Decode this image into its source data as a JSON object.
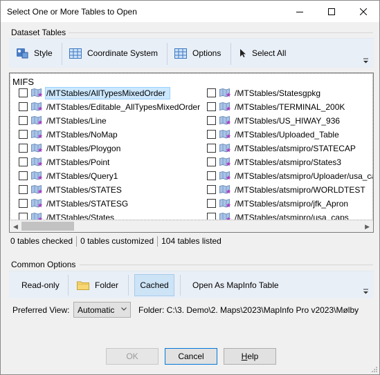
{
  "window": {
    "title": "Select One or More Tables to Open"
  },
  "dataset_group": {
    "label": "Dataset Tables",
    "toolbar": {
      "style": "Style",
      "coordinate_system": "Coordinate System",
      "options": "Options",
      "select_all": "Select All"
    }
  },
  "list": {
    "heading": "MIFS",
    "left_column": [
      "/MTStables/AllTypesMixedOrder",
      "/MTStables/Editable_AllTypesMixedOrder",
      "/MTStables/Line",
      "/MTStables/NoMap",
      "/MTStables/Ploygon",
      "/MTStables/Point",
      "/MTStables/Query1",
      "/MTStables/STATES",
      "/MTStables/STATESG",
      "/MTStables/States"
    ],
    "right_column": [
      "/MTStables/Statesgpkg",
      "/MTStables/TERMINAL_200K",
      "/MTStables/US_HIWAY_936",
      "/MTStables/Uploaded_Table",
      "/MTStables/atsmipro/STATECAP",
      "/MTStables/atsmipro/States3",
      "/MTStables/atsmipro/Uploader/usa_ca",
      "/MTStables/atsmipro/WORLDTEST",
      "/MTStables/atsmipro/jfk_Apron",
      "/MTStables/atsmipro/usa_caps"
    ],
    "selected_index": 0
  },
  "status": {
    "checked": "0 tables checked",
    "customized": "0 tables customized",
    "listed": "104 tables listed"
  },
  "common_group": {
    "label": "Common Options",
    "toolbar": {
      "read_only": "Read-only",
      "folder": "Folder",
      "cached": "Cached",
      "open_as_mapinfo": "Open As MapInfo Table"
    }
  },
  "preferred_view": {
    "label": "Preferred View:",
    "value": "Automatic",
    "folder_path": "Folder: C:\\3. Demo\\2. Maps\\2023\\MapInfo Pro v2023\\Mølby"
  },
  "buttons": {
    "ok": "OK",
    "cancel": "Cancel",
    "help": "Help"
  },
  "colors": {
    "toolbar_bg": "#e9eff7",
    "cached_active": "#cde3f6",
    "selection": "#cce8ff",
    "accent": "#0078d7"
  },
  "icons": {
    "style": "style-icon",
    "coordinate_system": "grid-icon",
    "options": "grid-icon",
    "select_all": "cursor-arrow-icon",
    "folder": "folder-icon",
    "table": "map-table-icon"
  }
}
